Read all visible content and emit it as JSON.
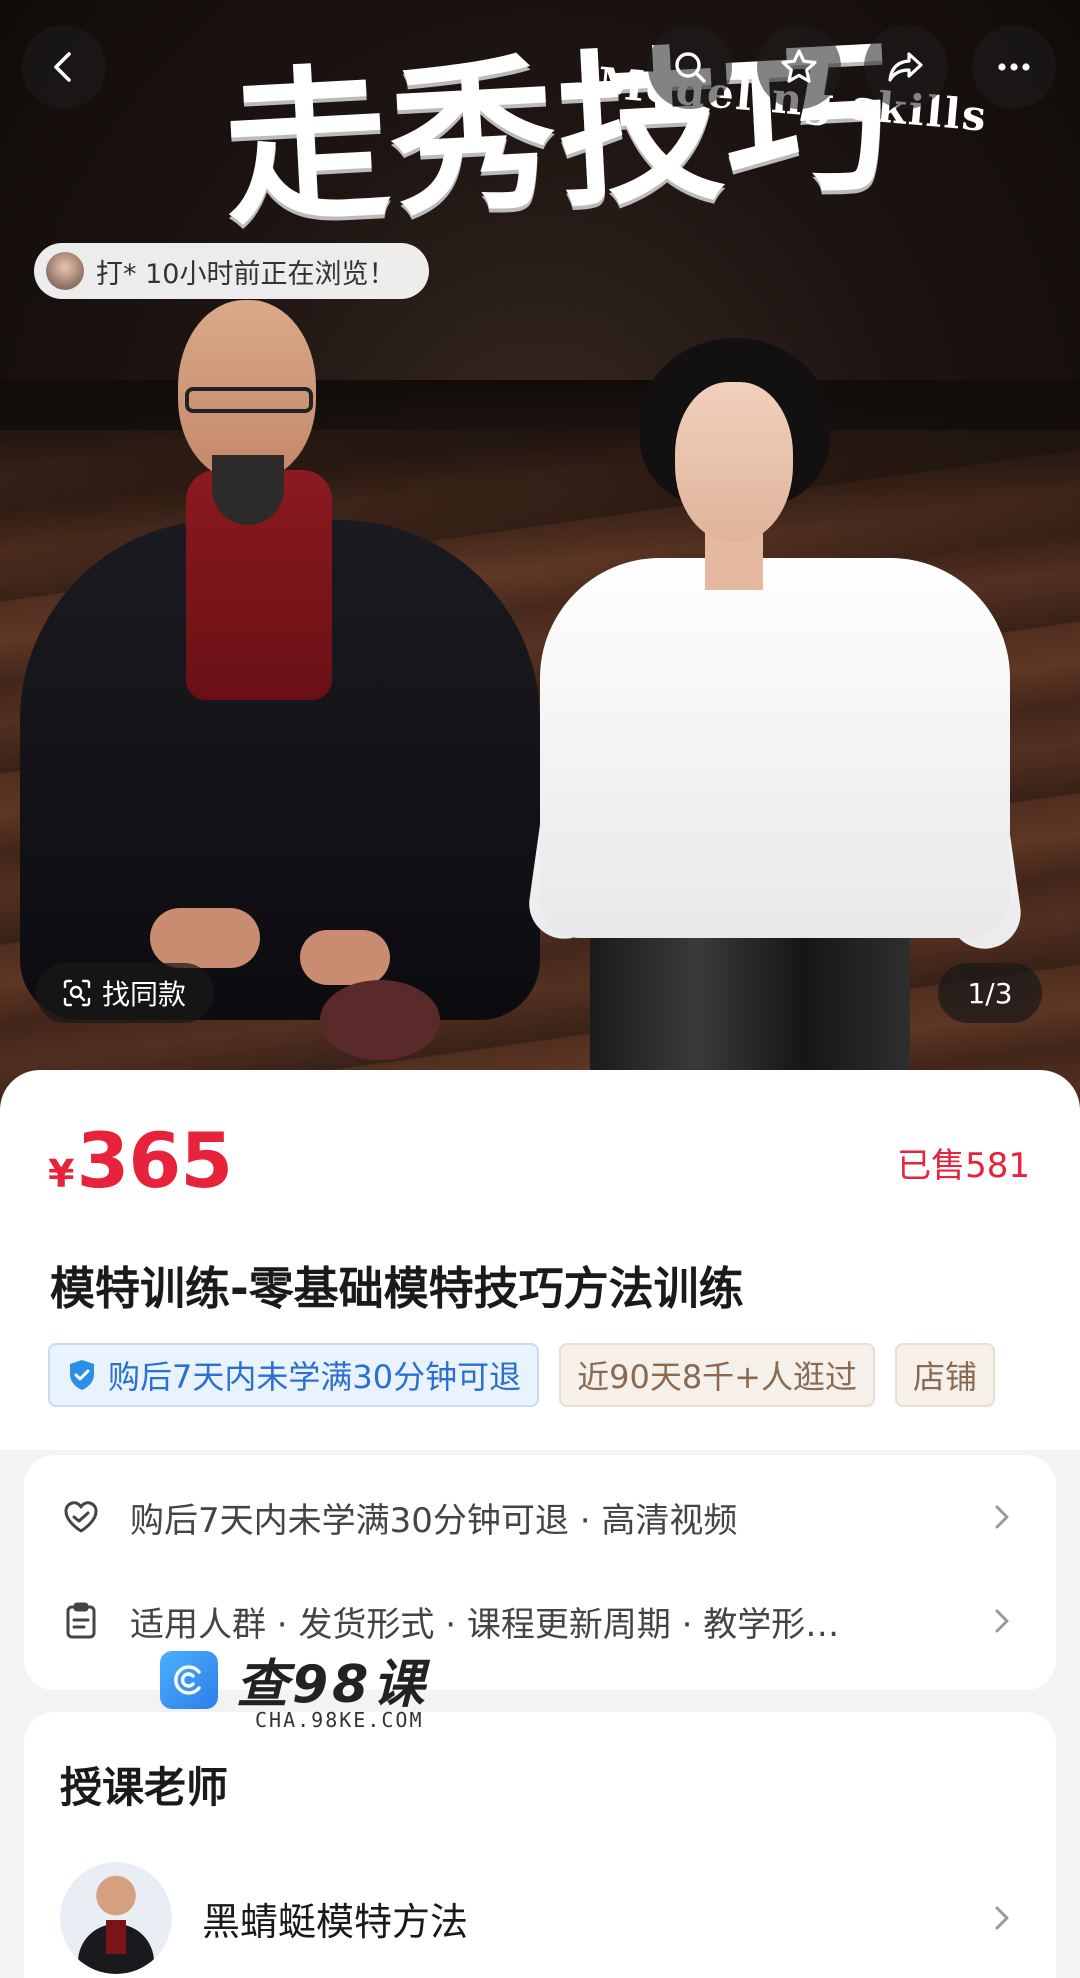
{
  "hero": {
    "title_cn": "走秀技巧",
    "title_en": "Modeling skills",
    "viewer_text": "打* 10小时前正在浏览！",
    "find_similar_label": "找同款",
    "page_indicator": "1/3"
  },
  "top_bar": {
    "icons": [
      "back-arrow-icon",
      "search-icon",
      "star-icon",
      "share-icon",
      "more-icon"
    ]
  },
  "product": {
    "currency": "¥",
    "price": "365",
    "sold": "已售581",
    "title": "模特训练-零基础模特技巧方法训练",
    "tags": [
      "购后7天内未学满30分钟可退",
      "近90天8千+人逛过",
      "店铺"
    ]
  },
  "services": {
    "row1": "购后7天内未学满30分钟可退 · 高清视频",
    "row2": "适用人群 · 发货形式 · 课程更新周期 · 教学形…"
  },
  "watermark": {
    "cn": "查98课",
    "en": "CHA.98KE.COM"
  },
  "teacher": {
    "heading": "授课老师",
    "name": "黑蜻蜓模特方法"
  },
  "colors": {
    "price_red": "#e8223a",
    "tag_blue": "#2b6fd0",
    "tag_brown": "#8a6a50"
  }
}
